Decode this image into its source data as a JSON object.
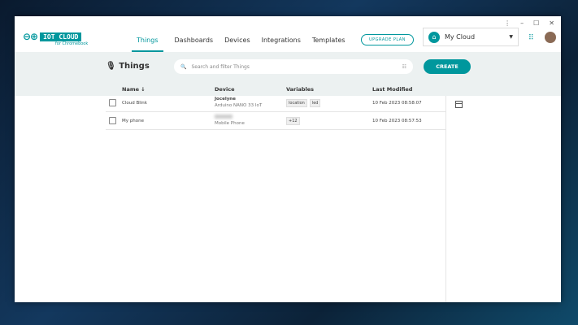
{
  "window": {
    "controls": [
      "⋮",
      "–",
      "☐",
      "✕"
    ]
  },
  "logo": {
    "title": "IOT CLOUD",
    "subtitle": "for Chromebook"
  },
  "nav": [
    "Things",
    "Dashboards",
    "Devices",
    "Integrations",
    "Templates"
  ],
  "upgrade_label": "UPGRADE PLAN",
  "space": {
    "label": "My Cloud"
  },
  "page": {
    "title": "Things",
    "search_placeholder": "Search and filter Things",
    "create_label": "CREATE"
  },
  "table": {
    "headers": {
      "name": "Name ↓",
      "device": "Device",
      "variables": "Variables",
      "modified": "Last Modified"
    },
    "rows": [
      {
        "name": "Cloud Blink",
        "device": "Jocelyne",
        "device_type": "Arduino NANO 33 IoT",
        "variables": [
          "location",
          "led"
        ],
        "modified": "10 Feb 2023 08:58:07"
      },
      {
        "name": "My phone",
        "device": "",
        "device_type": "Mobile Phone",
        "variables": [
          "+12"
        ],
        "modified": "10 Feb 2023 08:57:53"
      }
    ]
  },
  "colors": {
    "accent": "#00979d"
  }
}
